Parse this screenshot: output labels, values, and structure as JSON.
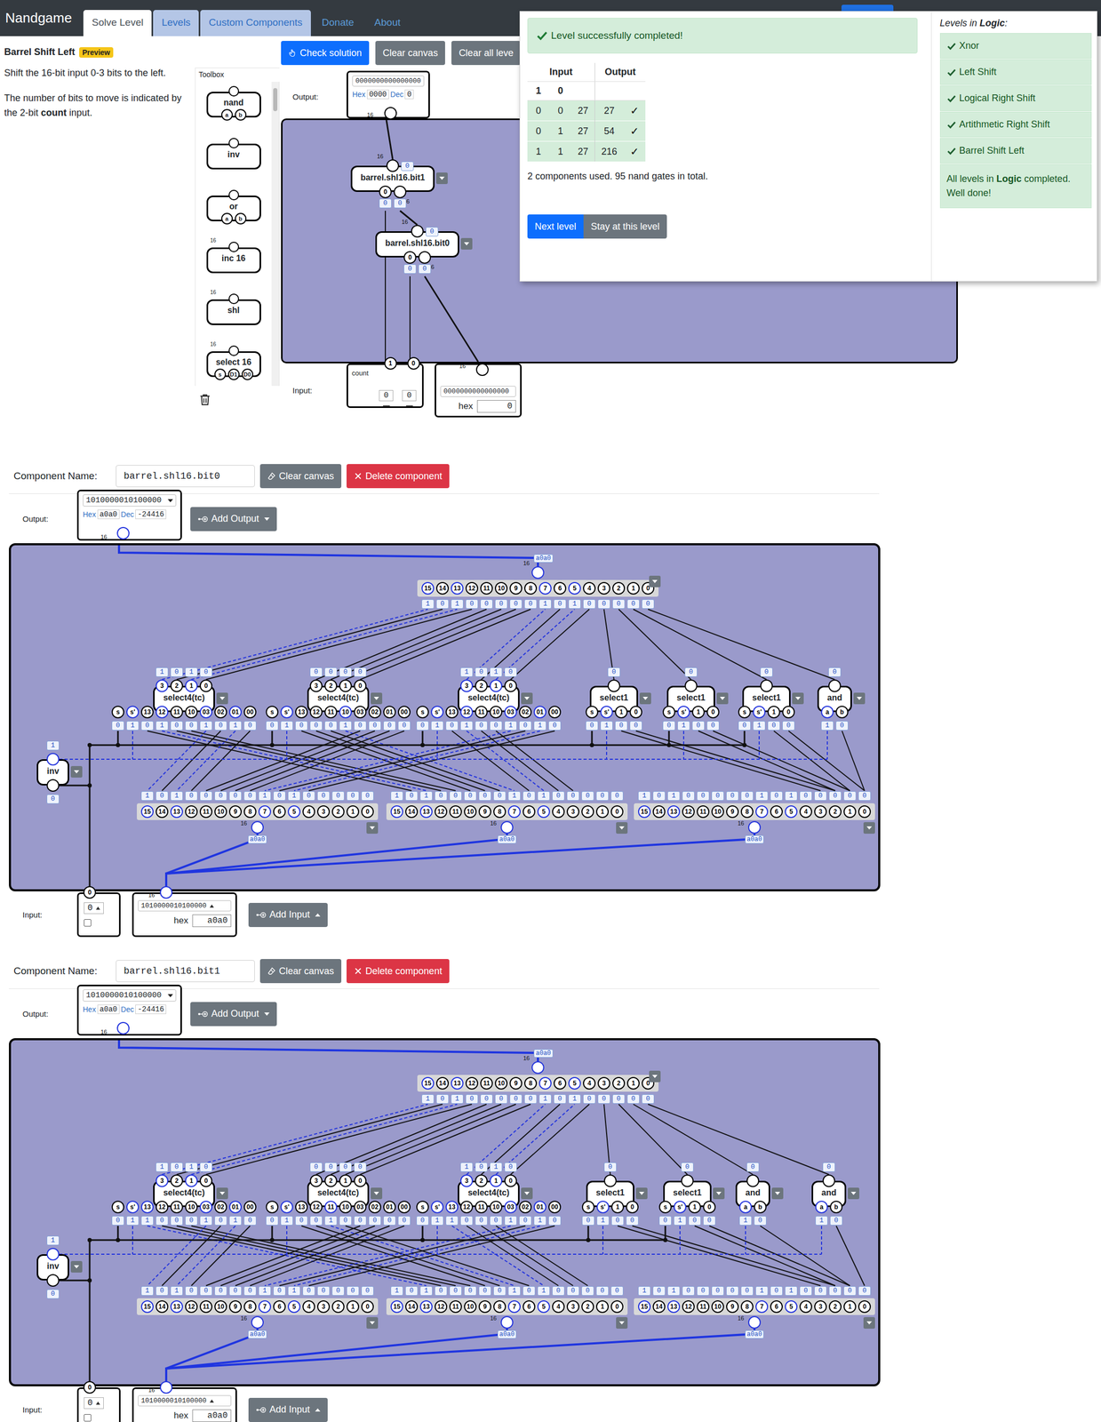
{
  "brand": "Nandgame",
  "nav_tabs": [
    {
      "label": "Solve Level",
      "selected": true,
      "kind": "tab"
    },
    {
      "label": "Levels",
      "selected": false,
      "kind": "tab"
    },
    {
      "label": "Custom Components",
      "selected": false,
      "kind": "tab"
    },
    {
      "label": "Donate",
      "selected": false,
      "kind": "link"
    },
    {
      "label": "About",
      "selected": false,
      "kind": "link"
    }
  ],
  "level": {
    "title": "Barrel Shift Left",
    "badge": "Preview",
    "paragraphs": [
      [
        {
          "text": "Shift the 16-bit input 0-3 bits to the left.",
          "bold": false
        }
      ],
      [
        {
          "text": "The number of bits to move is indicated by the 2-bit ",
          "bold": false
        },
        {
          "text": "count",
          "bold": true
        },
        {
          "text": " input.",
          "bold": false
        }
      ]
    ]
  },
  "toolbar": [
    {
      "label": "Check solution",
      "kind": "primary"
    },
    {
      "label": "Clear canvas",
      "kind": "secondary"
    },
    {
      "label": "Clear all leve",
      "kind": "secondary"
    }
  ],
  "toolbox": {
    "title": "Toolbox",
    "items": [
      {
        "name": "nand",
        "pins": [
          "a",
          "b"
        ],
        "width": ""
      },
      {
        "name": "inv",
        "pins": [],
        "width": ""
      },
      {
        "name": "or",
        "pins": [
          "a",
          "b"
        ],
        "width": ""
      },
      {
        "name": "inc 16",
        "pins": [],
        "width": "16"
      },
      {
        "name": "shl",
        "pins": [],
        "width": "16"
      },
      {
        "name": "select 16",
        "pins": [
          "s",
          "D1",
          "D0"
        ],
        "width": "16"
      }
    ]
  },
  "level_canvas": {
    "output": {
      "label": "Output:",
      "bits": "0000000000000000",
      "hex_label": "Hex",
      "hex": "0000",
      "dec_label": "Dec",
      "dec": "0",
      "bus": "16"
    },
    "components": [
      {
        "name": "barrel.shl16.bit1",
        "out_value": "0",
        "bus": "16",
        "inputs": [
          {
            "label": "0",
            "value": "0",
            "bus": ""
          },
          {
            "label": "",
            "value": "0",
            "bus": "16"
          }
        ]
      },
      {
        "name": "barrel.shl16.bit0",
        "out_value": "0",
        "bus": "16",
        "inputs": [
          {
            "label": "0",
            "value": "0",
            "bus": ""
          },
          {
            "label": "",
            "value": "0",
            "bus": "16"
          }
        ]
      }
    ],
    "input": {
      "label": "Input:",
      "count": {
        "label": "count",
        "pins": [
          {
            "label": "1",
            "value": "0",
            "checked": false
          },
          {
            "label": "0",
            "value": "0",
            "checked": false
          }
        ]
      },
      "data": {
        "bits": "0000000000000000",
        "hex_label": "hex",
        "hex": "0",
        "bus": "16"
      }
    }
  },
  "result": {
    "message": "Level successfully completed!",
    "headers": [
      "Input",
      "Output"
    ],
    "input_columns": [
      "1",
      "0",
      ""
    ],
    "rows": [
      {
        "inputs": [
          "0",
          "0",
          "27"
        ],
        "output": "27",
        "mark": "✓"
      },
      {
        "inputs": [
          "0",
          "1",
          "27"
        ],
        "output": "54",
        "mark": "✓"
      },
      {
        "inputs": [
          "1",
          "1",
          "27"
        ],
        "output": "216",
        "mark": "✓"
      }
    ],
    "summary": "2 components used. 95 nand gates in total.",
    "buttons": [
      {
        "label": "Next level",
        "kind": "primary"
      },
      {
        "label": "Stay at this level",
        "kind": "secondary"
      }
    ]
  },
  "levels": {
    "title_prefix": "Levels in ",
    "title_group": "Logic",
    "title_suffix": ":",
    "items": [
      {
        "label": "Xnor",
        "completed": true
      },
      {
        "label": "Left Shift",
        "completed": true
      },
      {
        "label": "Logical Right Shift",
        "completed": true
      },
      {
        "label": "Artithmetic Right Shift",
        "completed": true
      },
      {
        "label": "Barrel Shift Left",
        "completed": true
      }
    ],
    "done": {
      "prefix": "All levels in ",
      "group": "Logic",
      "suffix": " completed. Well done!"
    }
  },
  "editors": [
    {
      "name_label": "Component Name:",
      "name": "barrel.shl16.bit0",
      "clear_button": "Clear canvas",
      "delete_button": "Delete component",
      "output": {
        "label": "Output:",
        "bits": "1010000010100000",
        "hex_label": "Hex",
        "hex": "a0a0",
        "dec_label": "Dec",
        "dec": "-24416",
        "bus": "16"
      },
      "add_output": "Add Output",
      "bundler": {
        "label": "a0a0",
        "bus": "16",
        "pins": [
          "15",
          "14",
          "13",
          "12",
          "11",
          "10",
          "9",
          "8",
          "7",
          "6",
          "5",
          "4",
          "3",
          "2",
          "1",
          "0"
        ],
        "values": [
          "1",
          "0",
          "1",
          "0",
          "0",
          "0",
          "0",
          "0",
          "1",
          "0",
          "1",
          "0",
          "0",
          "0",
          "0",
          "0"
        ]
      },
      "gates": [
        {
          "kind": "select4",
          "title": "select4(tc)",
          "outputs": [
            "3",
            "2",
            "1",
            "0"
          ],
          "out_values": [
            "1",
            "0",
            "1",
            "0"
          ],
          "pins": [
            "s",
            "s'",
            "13",
            "12",
            "11",
            "10",
            "03",
            "02",
            "01",
            "00"
          ],
          "values": [
            "0",
            "1",
            "0",
            "1",
            "0",
            "0",
            "1",
            "0",
            "1",
            "0"
          ]
        },
        {
          "kind": "select4",
          "title": "select4(tc)",
          "outputs": [
            "3",
            "2",
            "1",
            "0"
          ],
          "out_values": [
            "0",
            "0",
            "0",
            "0"
          ],
          "pins": [
            "s",
            "s'",
            "13",
            "12",
            "11",
            "10",
            "03",
            "02",
            "01",
            "00"
          ],
          "values": [
            "0",
            "1",
            "0",
            "0",
            "0",
            "1",
            "0",
            "0",
            "0",
            "0"
          ]
        },
        {
          "kind": "select4",
          "title": "select4(tc)",
          "outputs": [
            "3",
            "2",
            "1",
            "0"
          ],
          "out_values": [
            "1",
            "0",
            "1",
            "0"
          ],
          "pins": [
            "s",
            "s'",
            "13",
            "12",
            "11",
            "10",
            "03",
            "02",
            "01",
            "00"
          ],
          "values": [
            "0",
            "1",
            "0",
            "1",
            "0",
            "0",
            "1",
            "0",
            "1",
            "0"
          ]
        },
        {
          "kind": "select1",
          "title": "select1",
          "outputs": [
            ""
          ],
          "out_values": [
            "0"
          ],
          "pins": [
            "s",
            "s'",
            "1",
            "0"
          ],
          "values": [
            "0",
            "1",
            "0",
            "0"
          ]
        },
        {
          "kind": "select1",
          "title": "select1",
          "outputs": [
            ""
          ],
          "out_values": [
            "0"
          ],
          "pins": [
            "s",
            "s'",
            "1",
            "0"
          ],
          "values": [
            "0",
            "1",
            "0",
            "0"
          ]
        },
        {
          "kind": "select1",
          "title": "select1",
          "outputs": [
            ""
          ],
          "out_values": [
            "0"
          ],
          "pins": [
            "s",
            "s'",
            "1",
            "0"
          ],
          "values": [
            "0",
            "1",
            "0",
            "0"
          ]
        },
        {
          "kind": "and",
          "title": "and",
          "outputs": [
            ""
          ],
          "out_values": [
            "0"
          ],
          "pins": [
            "a",
            "b"
          ],
          "values": [
            "1",
            "0"
          ]
        }
      ],
      "inv": {
        "title": "inv",
        "out_value": "1",
        "in_value": "0"
      },
      "splitters": [
        {
          "label": "a0a0",
          "bus": "16",
          "pins": [
            "15",
            "14",
            "13",
            "12",
            "11",
            "10",
            "9",
            "8",
            "7",
            "6",
            "5",
            "4",
            "3",
            "2",
            "1",
            "0"
          ],
          "values": [
            "1",
            "0",
            "1",
            "0",
            "0",
            "0",
            "0",
            "0",
            "1",
            "0",
            "1",
            "0",
            "0",
            "0",
            "0",
            "0"
          ]
        },
        {
          "label": "a0a0",
          "bus": "16",
          "pins": [
            "15",
            "14",
            "13",
            "12",
            "11",
            "10",
            "9",
            "8",
            "7",
            "6",
            "5",
            "4",
            "3",
            "2",
            "1",
            "0"
          ],
          "values": [
            "1",
            "0",
            "1",
            "0",
            "0",
            "0",
            "0",
            "0",
            "1",
            "0",
            "1",
            "0",
            "0",
            "0",
            "0",
            "0"
          ]
        },
        {
          "label": "a0a0",
          "bus": "16",
          "pins": [
            "15",
            "14",
            "13",
            "12",
            "11",
            "10",
            "9",
            "8",
            "7",
            "6",
            "5",
            "4",
            "3",
            "2",
            "1",
            "0"
          ],
          "values": [
            "1",
            "0",
            "1",
            "0",
            "0",
            "0",
            "0",
            "0",
            "1",
            "0",
            "1",
            "0",
            "0",
            "0",
            "0",
            "0"
          ]
        }
      ],
      "input": {
        "label": "Input:",
        "count": {
          "pin": "0",
          "value": "0",
          "checked": false
        },
        "data": {
          "bits": "1010000010100000",
          "hex_label": "hex",
          "hex": "a0a0",
          "bus": "16"
        }
      },
      "add_input": "Add Input"
    },
    {
      "name_label": "Component Name:",
      "name": "barrel.shl16.bit1",
      "clear_button": "Clear canvas",
      "delete_button": "Delete component",
      "output": {
        "label": "Output:",
        "bits": "1010000010100000",
        "hex_label": "Hex",
        "hex": "a0a0",
        "dec_label": "Dec",
        "dec": "-24416",
        "bus": "16"
      },
      "add_output": "Add Output",
      "bundler": {
        "label": "a0a0",
        "bus": "16",
        "pins": [
          "15",
          "14",
          "13",
          "12",
          "11",
          "10",
          "9",
          "8",
          "7",
          "6",
          "5",
          "4",
          "3",
          "2",
          "1",
          "0"
        ],
        "values": [
          "1",
          "0",
          "1",
          "0",
          "0",
          "0",
          "0",
          "0",
          "1",
          "0",
          "1",
          "0",
          "0",
          "0",
          "0",
          "0"
        ]
      },
      "gates": [
        {
          "kind": "select4",
          "title": "select4(tc)",
          "outputs": [
            "3",
            "2",
            "1",
            "0"
          ],
          "out_values": [
            "1",
            "0",
            "1",
            "0"
          ],
          "pins": [
            "s",
            "s'",
            "13",
            "12",
            "11",
            "10",
            "03",
            "02",
            "01",
            "00"
          ],
          "values": [
            "0",
            "1",
            "1",
            "0",
            "0",
            "0",
            "1",
            "0",
            "1",
            "0"
          ]
        },
        {
          "kind": "select4",
          "title": "select4(tc)",
          "outputs": [
            "3",
            "2",
            "1",
            "0"
          ],
          "out_values": [
            "0",
            "0",
            "0",
            "0"
          ],
          "pins": [
            "s",
            "s'",
            "13",
            "12",
            "11",
            "10",
            "03",
            "02",
            "01",
            "00"
          ],
          "values": [
            "0",
            "1",
            "0",
            "0",
            "1",
            "0",
            "0",
            "0",
            "0",
            "0"
          ]
        },
        {
          "kind": "select4",
          "title": "select4(tc)",
          "outputs": [
            "3",
            "2",
            "1",
            "0"
          ],
          "out_values": [
            "1",
            "0",
            "1",
            "0"
          ],
          "pins": [
            "s",
            "s'",
            "13",
            "12",
            "11",
            "10",
            "03",
            "02",
            "01",
            "00"
          ],
          "values": [
            "0",
            "1",
            "1",
            "0",
            "0",
            "0",
            "1",
            "0",
            "1",
            "0"
          ]
        },
        {
          "kind": "select1",
          "title": "select1",
          "outputs": [
            ""
          ],
          "out_values": [
            "0"
          ],
          "pins": [
            "s",
            "s'",
            "1",
            "0"
          ],
          "values": [
            "0",
            "1",
            "0",
            "0"
          ]
        },
        {
          "kind": "select1",
          "title": "select1",
          "outputs": [
            ""
          ],
          "out_values": [
            "0"
          ],
          "pins": [
            "s",
            "s'",
            "1",
            "0"
          ],
          "values": [
            "0",
            "1",
            "0",
            "0"
          ]
        },
        {
          "kind": "and",
          "title": "and",
          "outputs": [
            ""
          ],
          "out_values": [
            "0"
          ],
          "pins": [
            "a",
            "b"
          ],
          "values": [
            "1",
            "0"
          ]
        },
        {
          "kind": "and",
          "title": "and",
          "outputs": [
            ""
          ],
          "out_values": [
            "0"
          ],
          "pins": [
            "a",
            "b"
          ],
          "values": [
            "1",
            "0"
          ]
        }
      ],
      "inv": {
        "title": "inv",
        "out_value": "1",
        "in_value": "0"
      },
      "splitters": [
        {
          "label": "a0a0",
          "bus": "16",
          "pins": [
            "15",
            "14",
            "13",
            "12",
            "11",
            "10",
            "9",
            "8",
            "7",
            "6",
            "5",
            "4",
            "3",
            "2",
            "1",
            "0"
          ],
          "values": [
            "1",
            "0",
            "1",
            "0",
            "0",
            "0",
            "0",
            "0",
            "1",
            "0",
            "1",
            "0",
            "0",
            "0",
            "0",
            "0"
          ]
        },
        {
          "label": "a0a0",
          "bus": "16",
          "pins": [
            "15",
            "14",
            "13",
            "12",
            "11",
            "10",
            "9",
            "8",
            "7",
            "6",
            "5",
            "4",
            "3",
            "2",
            "1",
            "0"
          ],
          "values": [
            "1",
            "0",
            "1",
            "0",
            "0",
            "0",
            "0",
            "0",
            "1",
            "0",
            "1",
            "0",
            "0",
            "0",
            "0",
            "0"
          ]
        },
        {
          "label": "a0a0",
          "bus": "16",
          "pins": [
            "15",
            "14",
            "13",
            "12",
            "11",
            "10",
            "9",
            "8",
            "7",
            "6",
            "5",
            "4",
            "3",
            "2",
            "1",
            "0"
          ],
          "values": [
            "1",
            "0",
            "1",
            "0",
            "0",
            "0",
            "0",
            "0",
            "1",
            "0",
            "1",
            "0",
            "0",
            "0",
            "0",
            "0"
          ]
        }
      ],
      "input": {
        "label": "Input:",
        "count": {
          "pin": "0",
          "value": "0",
          "checked": false
        },
        "data": {
          "bits": "1010000010100000",
          "hex_label": "hex",
          "hex": "a0a0",
          "bus": "16"
        }
      },
      "add_input": "Add Input"
    }
  ]
}
